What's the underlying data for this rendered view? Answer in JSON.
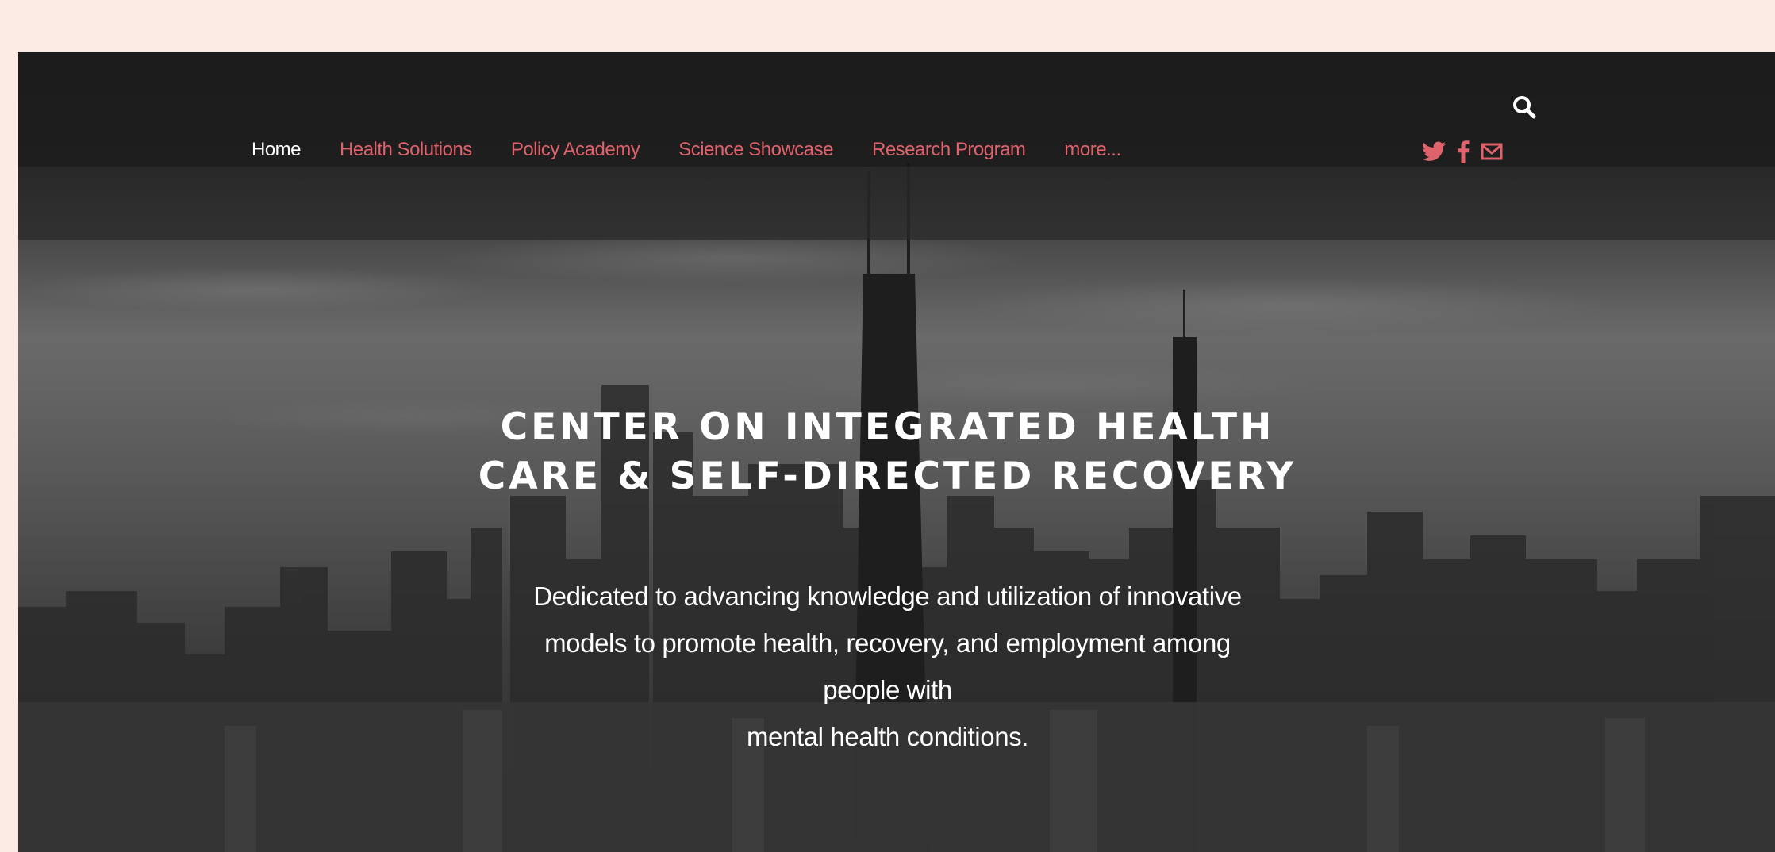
{
  "header": {
    "search_icon": "search-icon"
  },
  "nav": {
    "items": [
      {
        "label": "Home",
        "active": true
      },
      {
        "label": "Health Solutions"
      },
      {
        "label": "Policy Academy"
      },
      {
        "label": "Science Showcase"
      },
      {
        "label": "Research Program"
      },
      {
        "label": "more..."
      }
    ],
    "active_color": "#ffffff",
    "link_color": "#e0626c"
  },
  "social": {
    "icons": [
      "twitter-icon",
      "facebook-icon",
      "mail-icon"
    ],
    "color": "#e0626c"
  },
  "hero": {
    "title_line1": "CENTER ON INTEGRATED HEALTH",
    "title_line2": "CARE & SELF-DIRECTED RECOVERY",
    "subtitle_line1": "Dedicated to advancing knowledge and utilization of innovative",
    "subtitle_line2": "models to promote health, recovery, and employment among",
    "subtitle_line3": "people with",
    "subtitle_line4": "mental health conditions."
  }
}
